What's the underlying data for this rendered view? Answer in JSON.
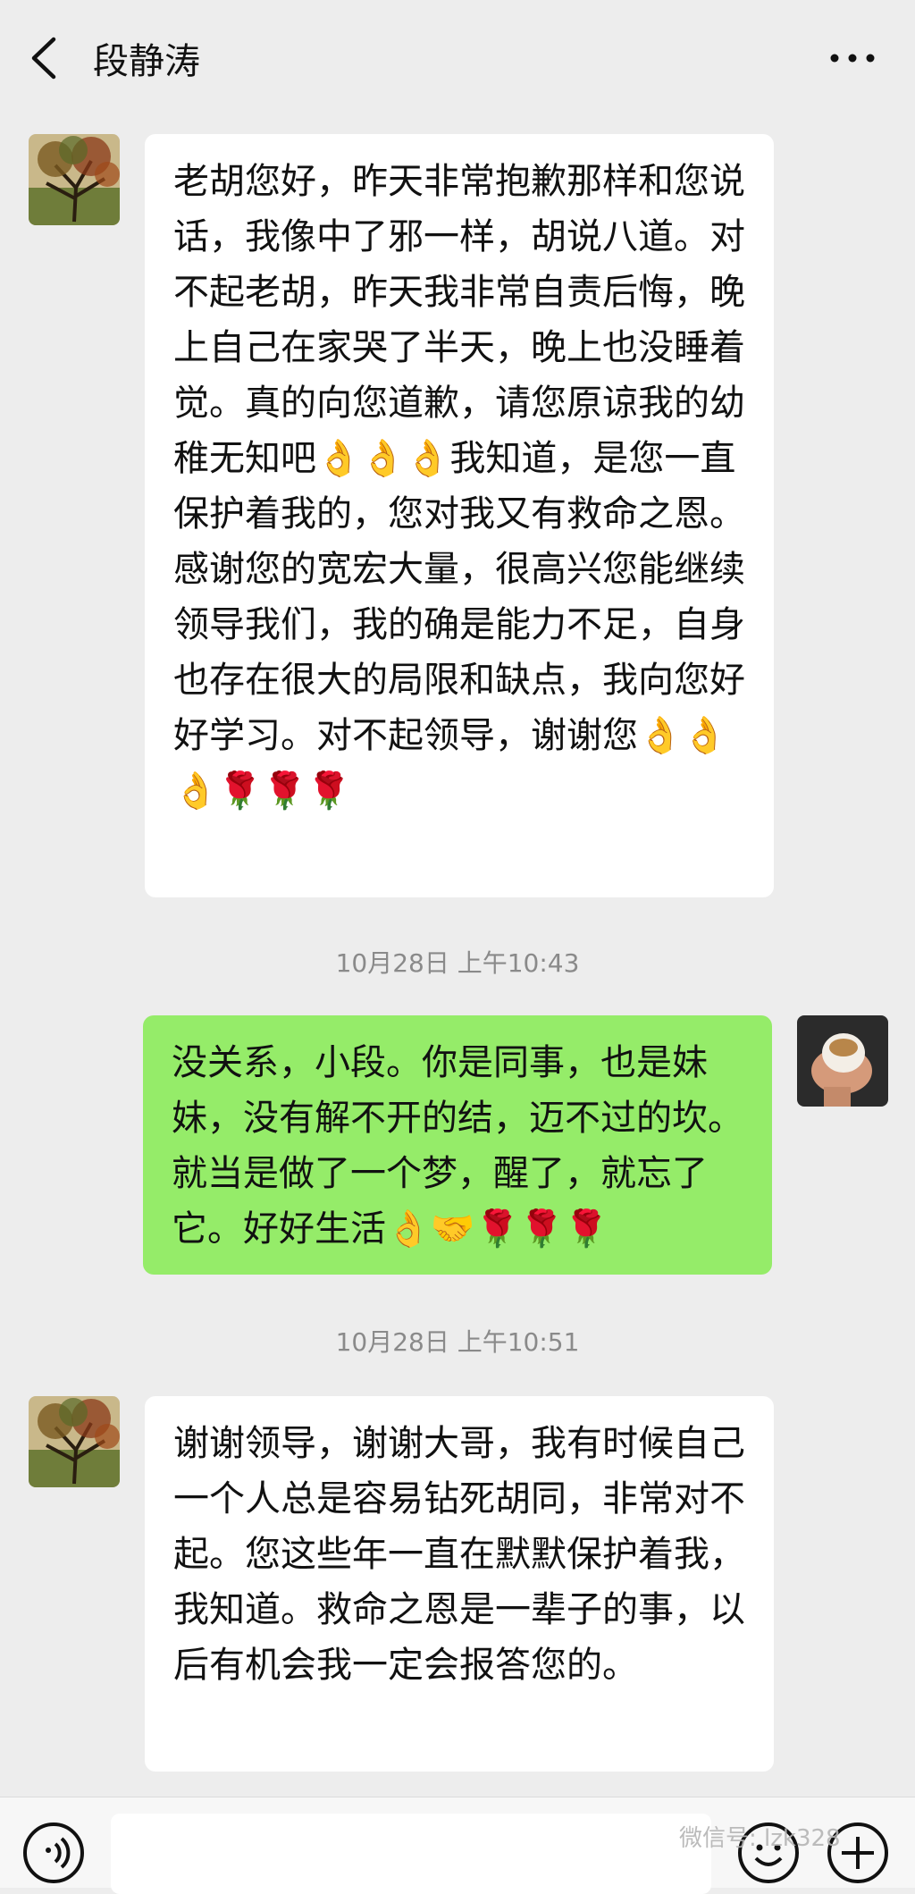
{
  "header": {
    "title": "段静涛",
    "back_icon": "chevron-left-icon",
    "more_icon": "more-dots-icon"
  },
  "messages": [
    {
      "direction": "incoming",
      "text": "老胡您好，昨天非常抱歉那样和您说话，我像中了邪一样，胡说八道。对不起老胡，昨天我非常自责后悔，晚上自己在家哭了半天，晚上也没睡着觉。真的向您道歉，请您原谅我的幼稚无知吧👌👌👌我知道，是您一直保护着我的，您对我又有救命之恩。感谢您的宽宏大量，很高兴您能继续领导我们，我的确是能力不足，自身也存在很大的局限和缺点，我向您好好学习。对不起领导，谢谢您👌👌👌🌹🌹🌹"
    },
    {
      "timestamp": "10月28日 上午10:43"
    },
    {
      "direction": "outgoing",
      "text": "没关系，小段。你是同事，也是妹妹，没有解不开的结，迈不过的坎。就当是做了一个梦，醒了，就忘了它。好好生活👌🤝🌹🌹🌹"
    },
    {
      "timestamp": "10月28日 上午10:51"
    },
    {
      "direction": "incoming",
      "text": "谢谢领导，谢谢大哥，我有时候自己一个人总是容易钻死胡同，非常对不起。您这些年一直在默默保护着我，我知道。救命之恩是一辈子的事，以后有机会我一定会报答您的。"
    }
  ],
  "bottom": {
    "watermark": "微信号: lzk328",
    "voice_icon": "voice-icon",
    "emoji_icon": "emoji-icon",
    "plus_icon": "plus-icon"
  },
  "colors": {
    "background": "#ededed",
    "incoming_bubble": "#ffffff",
    "outgoing_bubble": "#95ec69"
  }
}
